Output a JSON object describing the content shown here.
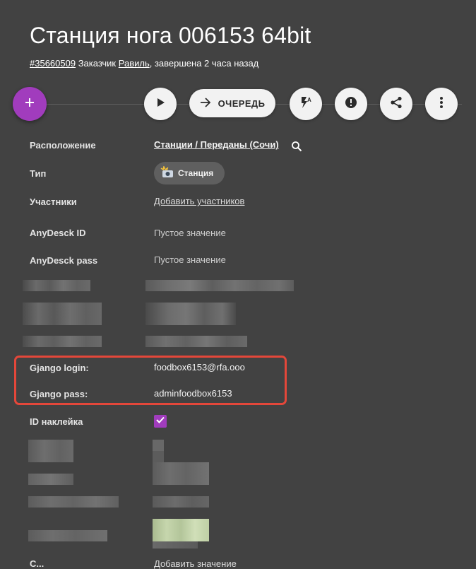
{
  "header": {
    "title": "Станция нога 006153 64bit",
    "ticket_id": "#35660509",
    "customer_prefix": "Заказчик",
    "customer_name": "Равиль",
    "status_text": ", завершена 2 часа назад"
  },
  "toolbar": {
    "add_icon": "plus-icon",
    "play_icon": "play-icon",
    "queue_label": "ОЧЕРЕДЬ",
    "queue_icon": "arrow-right-icon",
    "flash_icon": "flash-auto-icon",
    "alert_icon": "alert-circle-icon",
    "share_icon": "share-icon",
    "more_icon": "more-vert-icon"
  },
  "fields": {
    "location": {
      "label": "Расположение",
      "value": "Станции / Переданы (Сочи)"
    },
    "type": {
      "label": "Тип",
      "value": "Станция",
      "icon": "camera-flash-icon"
    },
    "participants": {
      "label": "Участники",
      "value": "Добавить участников"
    },
    "anydesk_id": {
      "label": "AnyDesck ID",
      "value": "Пустое значение"
    },
    "anydesk_pass": {
      "label": "AnyDesck pass",
      "value": "Пустое значение"
    },
    "gjango_login": {
      "label": "Gjango login:",
      "value": "foodbox6153@rfa.ooo"
    },
    "gjango_pass": {
      "label": "Gjango pass:",
      "value": "adminfoodbox6153"
    },
    "id_sticker": {
      "label": "ID наклейка",
      "checked": true
    }
  },
  "partial_bottom": {
    "label": "С...",
    "value": "Добавить значение"
  },
  "colors": {
    "background": "#424242",
    "accent": "#a13cbd",
    "highlight": "#e4473a",
    "button": "#f2f2f2"
  }
}
